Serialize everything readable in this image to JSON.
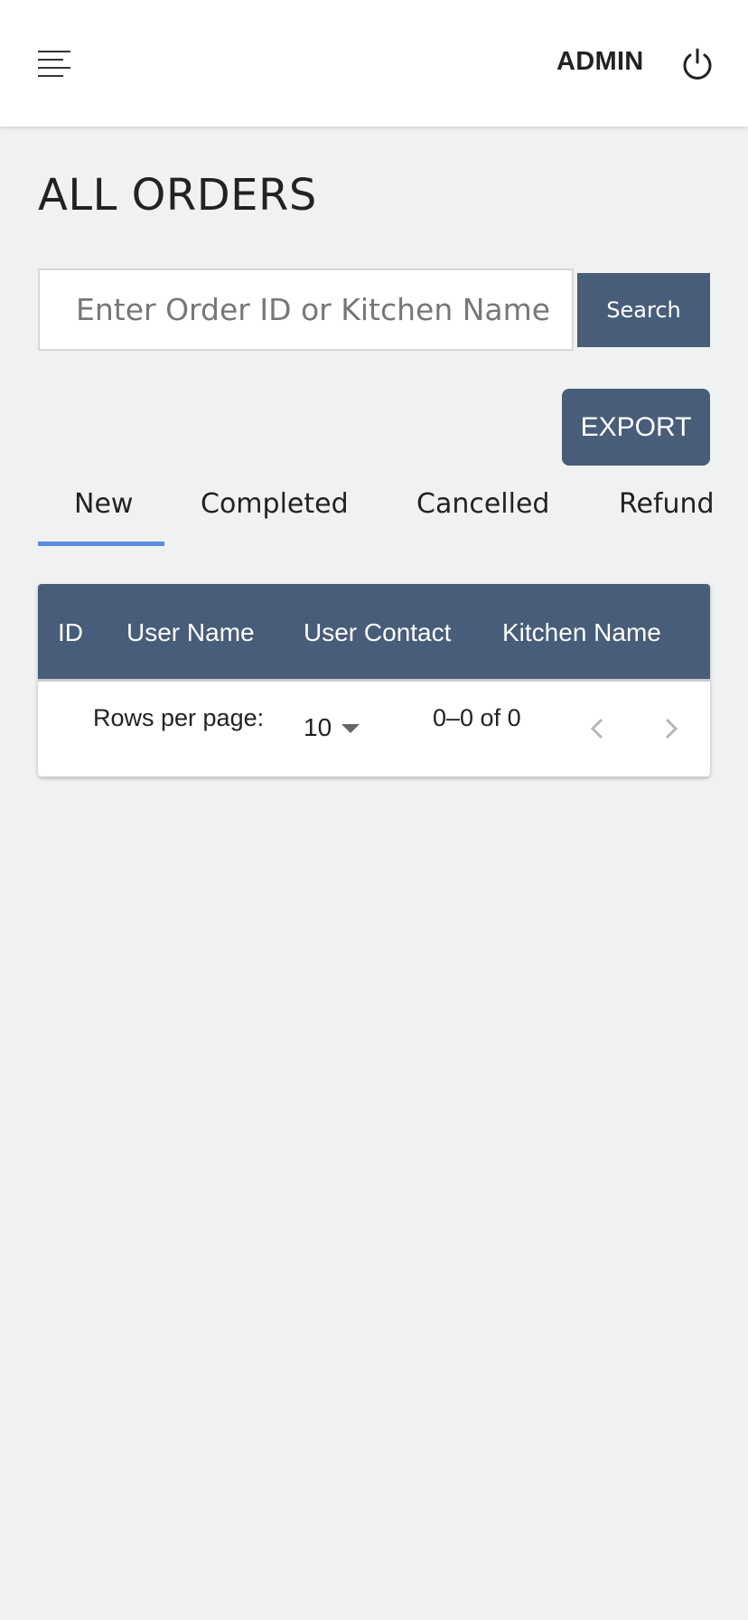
{
  "header": {
    "menu_icon": "menu-lines-icon",
    "user_label": "ADMIN",
    "logout_icon": "power-icon"
  },
  "page": {
    "title": "ALL ORDERS"
  },
  "search": {
    "placeholder": "Enter Order ID or Kitchen Name",
    "value": "",
    "button_label": "Search"
  },
  "actions": {
    "export_label": "EXPORT"
  },
  "tabs": [
    {
      "label": "New",
      "active": true
    },
    {
      "label": "Completed",
      "active": false
    },
    {
      "label": "Cancelled",
      "active": false
    },
    {
      "label": "Refund",
      "active": false
    }
  ],
  "table": {
    "columns": [
      "ID",
      "User Name",
      "User Contact",
      "Kitchen Name"
    ],
    "rows": []
  },
  "pagination": {
    "rows_per_page_label": "Rows per page:",
    "rows_per_page_value": "10",
    "range_text": "0–0 of 0",
    "prev_icon": "chevron-left-icon",
    "next_icon": "chevron-right-icon"
  },
  "colors": {
    "accent": "#475d79",
    "tab_indicator": "#5b8ee0",
    "background": "#f0f2f1"
  }
}
